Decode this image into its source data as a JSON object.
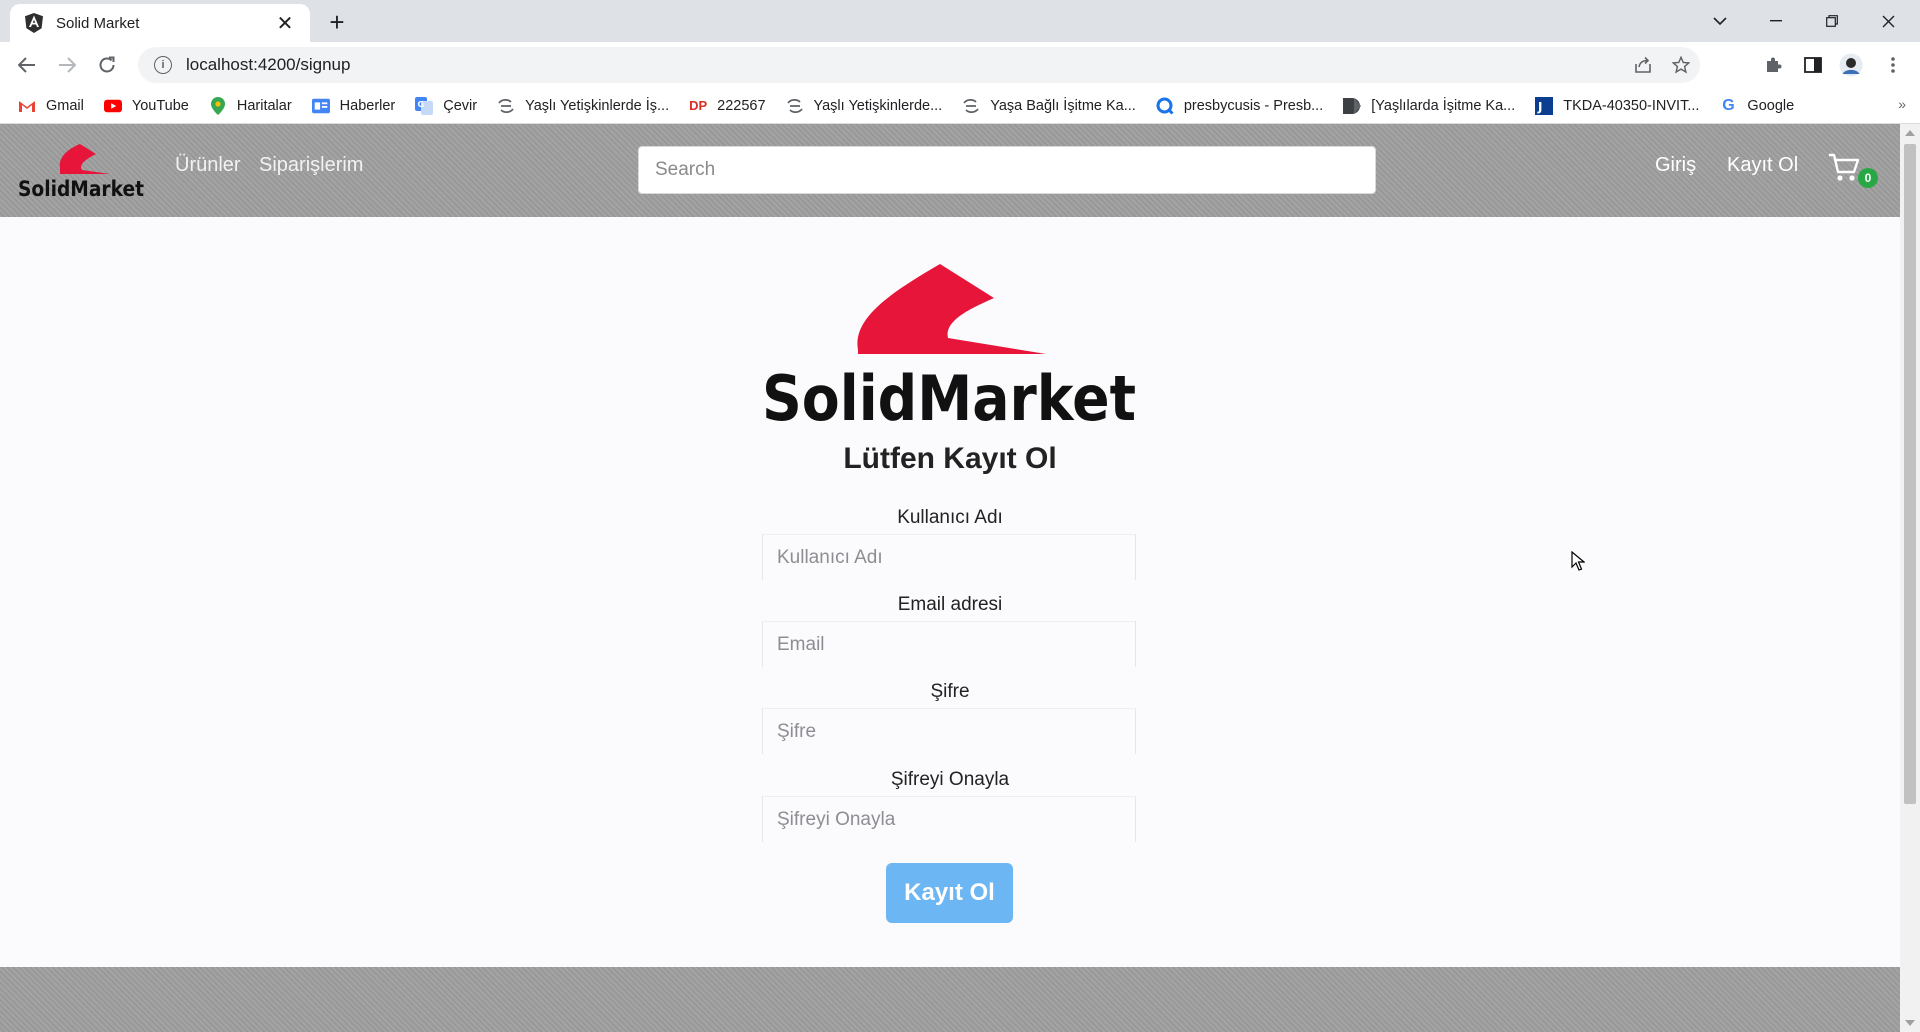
{
  "browser": {
    "tab_title": "Solid Market",
    "url": "localhost:4200/signup",
    "bookmarks": [
      {
        "label": "Gmail",
        "icon": "gmail-icon",
        "color": "#ea4335"
      },
      {
        "label": "YouTube",
        "icon": "youtube-icon",
        "color": "#ff0000"
      },
      {
        "label": "Haritalar",
        "icon": "maps-pin-icon",
        "color": "#34a853"
      },
      {
        "label": "Haberler",
        "icon": "news-icon",
        "color": "#4285f4"
      },
      {
        "label": "Çevir",
        "icon": "translate-icon",
        "color": "#4285f4"
      },
      {
        "label": "Yaşlı Yetişkinlerde İş...",
        "icon": "link-icon",
        "color": "#5f6368"
      },
      {
        "label": "222567",
        "icon": "dp-icon",
        "color": "#d93025"
      },
      {
        "label": "Yaşlı Yetişkinlerde...",
        "icon": "link-icon",
        "color": "#5f6368"
      },
      {
        "label": "Yaşa Bağlı İşitme Ka...",
        "icon": "link-icon",
        "color": "#5f6368"
      },
      {
        "label": "presbycusis - Presb...",
        "icon": "search-q-icon",
        "color": "#1a73e8"
      },
      {
        "label": "[Yaşlılarda İşitme Ka...",
        "icon": "bookmark-d-icon",
        "color": "#3c4043"
      },
      {
        "label": "TKDA-40350-INVIT...",
        "icon": "jira-icon",
        "color": "#0b3d91"
      },
      {
        "label": "Google",
        "icon": "google-icon",
        "color": "#4285f4"
      }
    ]
  },
  "app": {
    "brand_color": "#e8153a",
    "nav": {
      "links": [
        "Ürünler",
        "Siparişlerim"
      ],
      "search_placeholder": "Search",
      "login": "Giriş",
      "signup": "Kayıt Ol",
      "cart_count": "0"
    },
    "form": {
      "title": "Lütfen Kayıt Ol",
      "fields": [
        {
          "label": "Kullanıcı Adı",
          "placeholder": "Kullanıcı Adı"
        },
        {
          "label": "Email adresi",
          "placeholder": "Email"
        },
        {
          "label": "Şifre",
          "placeholder": "Şifre"
        },
        {
          "label": "Şifreyi Onayla",
          "placeholder": "Şifreyi Onayla"
        }
      ],
      "submit": "Kayıt Ol"
    }
  }
}
